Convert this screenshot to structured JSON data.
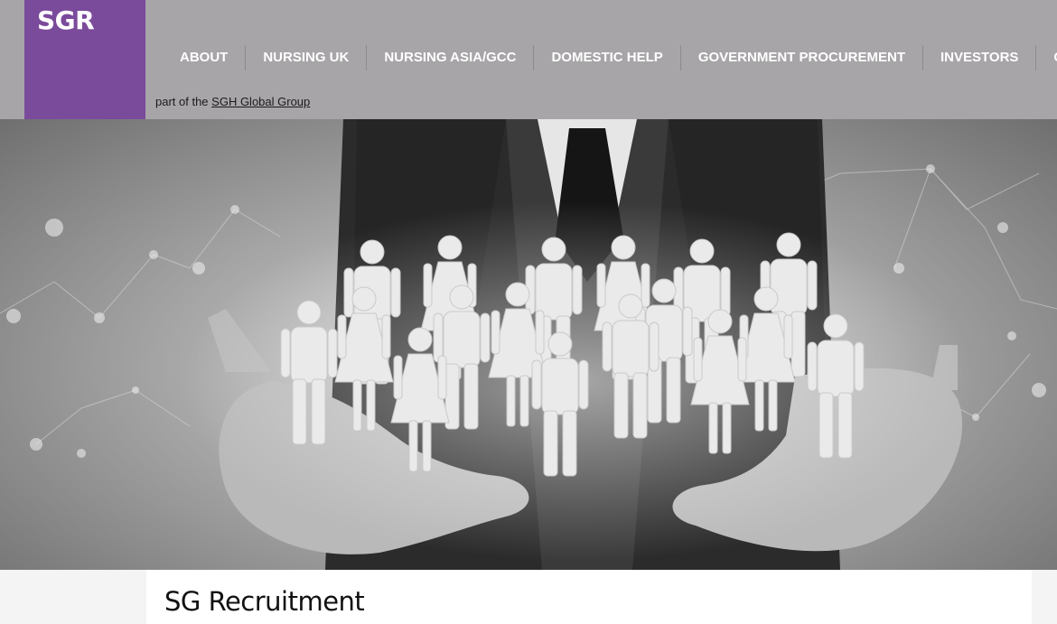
{
  "logo": {
    "text": "SGR",
    "bg_color": "#7a4a9b"
  },
  "nav": {
    "items": [
      {
        "label": "ABOUT"
      },
      {
        "label": "NURSING UK"
      },
      {
        "label": "NURSING ASIA/GCC"
      },
      {
        "label": "DOMESTIC HELP"
      },
      {
        "label": "GOVERNMENT PROCUREMENT"
      },
      {
        "label": "INVESTORS"
      },
      {
        "label": "CON"
      }
    ]
  },
  "tagline": {
    "prefix": "part of the ",
    "link": "SGH Global Group"
  },
  "hero": {
    "image": "businessman-hands-holding-people-icons"
  },
  "content": {
    "title": "SG Recruitment"
  },
  "colors": {
    "header_bg": "#a7a5a7",
    "brand_purple": "#7a4a9b",
    "nav_text": "#ffffff"
  }
}
